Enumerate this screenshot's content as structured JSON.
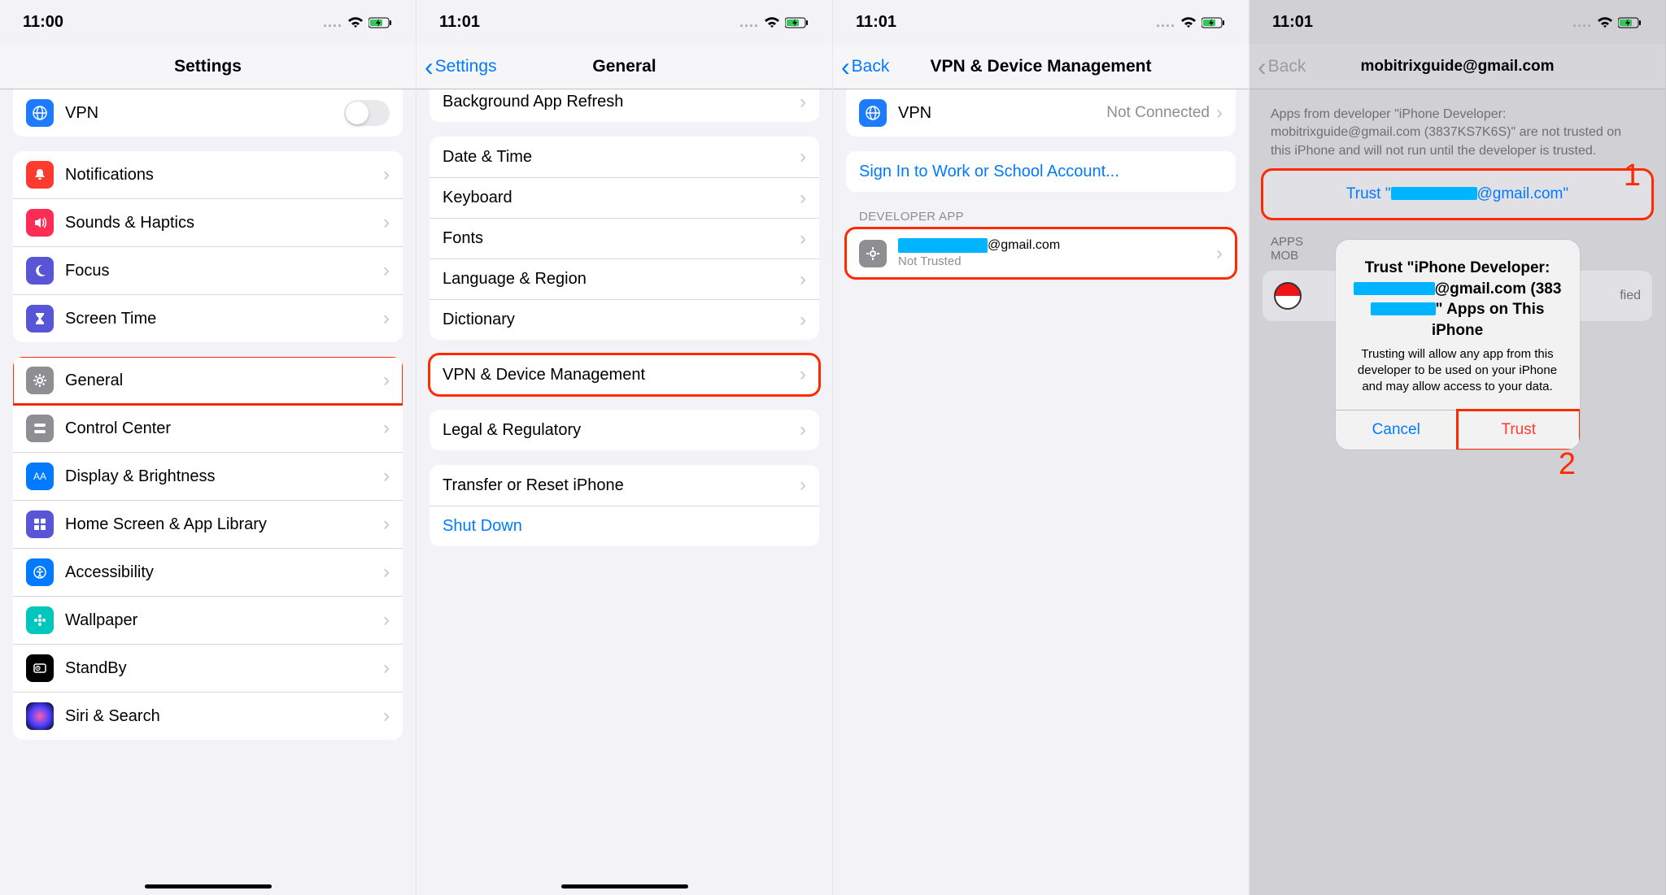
{
  "p1": {
    "time": "11:00",
    "title": "Settings",
    "vpn": "VPN",
    "items1": [
      "Notifications",
      "Sounds & Haptics",
      "Focus",
      "Screen Time"
    ],
    "items2": [
      "General",
      "Control Center",
      "Display & Brightness",
      "Home Screen & App Library",
      "Accessibility",
      "Wallpaper",
      "StandBy",
      "Siri & Search"
    ]
  },
  "p2": {
    "time": "11:01",
    "back": "Settings",
    "title": "General",
    "partial": "Background App Refresh",
    "g1": [
      "Date & Time",
      "Keyboard",
      "Fonts",
      "Language & Region",
      "Dictionary"
    ],
    "g2": [
      "VPN & Device Management"
    ],
    "g3": [
      "Legal & Regulatory"
    ],
    "g4": [
      "Transfer or Reset iPhone"
    ],
    "shutdown": "Shut Down"
  },
  "p3": {
    "time": "11:01",
    "back": "Back",
    "title": "VPN & Device Management",
    "vpn": "VPN",
    "vpn_status": "Not Connected",
    "signin": "Sign In to Work or School Account...",
    "section": "DEVELOPER APP",
    "dev_suffix": "@gmail.com",
    "dev_status": "Not Trusted"
  },
  "p4": {
    "time": "11:01",
    "back": "Back",
    "title": "mobitrixguide@gmail.com",
    "desc": "Apps from developer \"iPhone Developer: mobitrixguide@gmail.com (3837KS7K6S)\" are not trusted on this iPhone and will not run until the developer is trusted.",
    "trust_prefix": "Trust \"",
    "trust_suffix": "@gmail.com\"",
    "apps_section": "APPS FROM DEVELOPER ...",
    "verified": "Verified",
    "alert_title_1": "Trust \"iPhone Developer:",
    "alert_title_mid": "@gmail.com (383",
    "alert_title_end": "\" Apps on This iPhone",
    "alert_sub": "Trusting will allow any app from this developer to be used on your iPhone and may allow access to your data.",
    "cancel": "Cancel",
    "trust": "Trust",
    "annot1": "1",
    "annot2": "2"
  },
  "icons": {
    "vpn": "#1d7bff",
    "notif": "#ff3b30",
    "sounds": "#ff2d55",
    "focus": "#5856d6",
    "screentime": "#5856d6",
    "general": "#8e8e93",
    "controlcenter": "#8e8e93",
    "display": "#007aff",
    "homescreen": "#4f46e5",
    "accessibility": "#007aff",
    "wallpaper": "#00c7be",
    "standby": "#000",
    "siri": "#222",
    "dev": "#8e8e93"
  }
}
